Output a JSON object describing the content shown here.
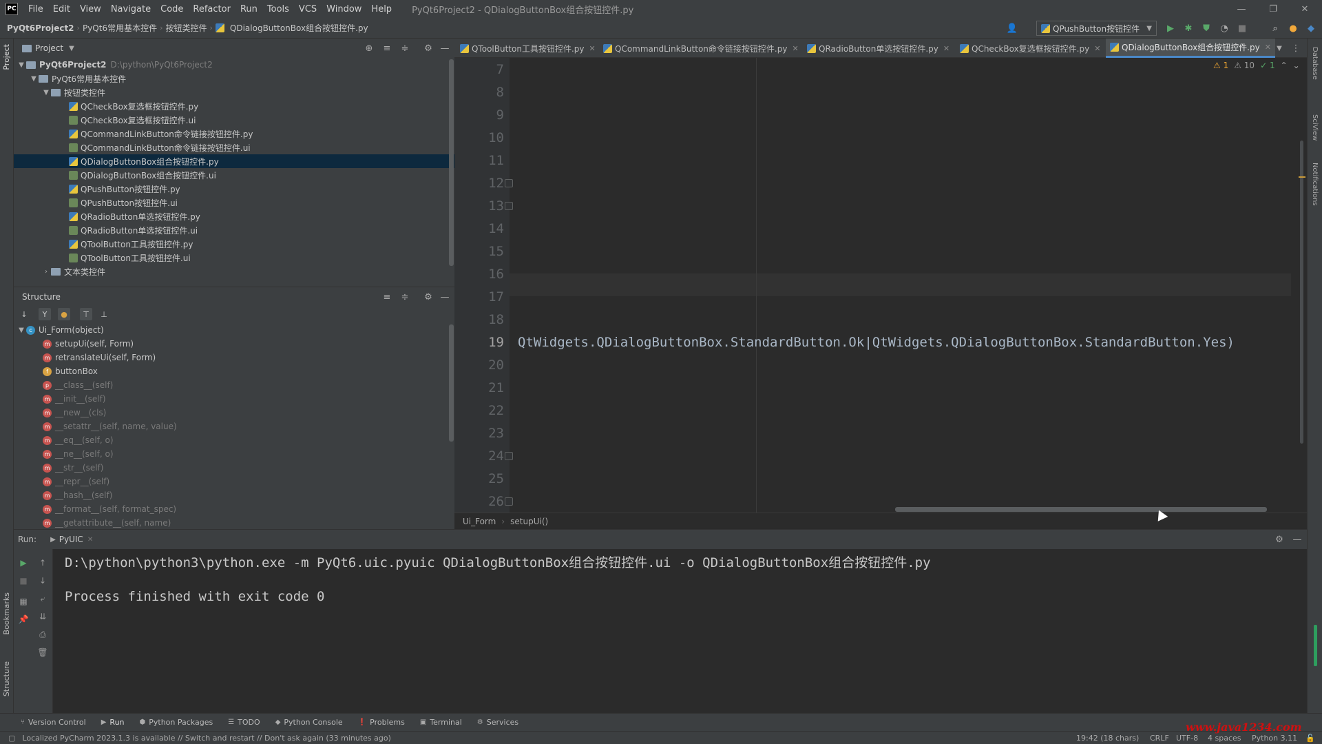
{
  "window": {
    "title": "PyQt6Project2 - QDialogButtonBox组合按钮控件.py",
    "logo": "PC"
  },
  "menu": [
    "File",
    "Edit",
    "View",
    "Navigate",
    "Code",
    "Refactor",
    "Run",
    "Tools",
    "VCS",
    "Window",
    "Help"
  ],
  "navbar": {
    "crumbs": [
      "PyQt6Project2",
      "PyQt6常用基本控件",
      "按钮类控件",
      "QDialogButtonBox组合按钮控件.py"
    ],
    "run_config": "QPushButton按钮控件"
  },
  "project": {
    "title": "Project",
    "root": "PyQt6Project2",
    "root_path": "D:\\python\\PyQt6Project2",
    "folder1": "PyQt6常用基本控件",
    "folder2": "按钮类控件",
    "files": [
      "QCheckBox复选框按钮控件.py",
      "QCheckBox复选框按钮控件.ui",
      "QCommandLinkButton命令链接按钮控件.py",
      "QCommandLinkButton命令链接按钮控件.ui",
      "QDialogButtonBox组合按钮控件.py",
      "QDialogButtonBox组合按钮控件.ui",
      "QPushButton按钮控件.py",
      "QPushButton按钮控件.ui",
      "QRadioButton单选按钮控件.py",
      "QRadioButton单选按钮控件.ui",
      "QToolButton工具按钮控件.py",
      "QToolButton工具按钮控件.ui"
    ],
    "folder3": "文本类控件"
  },
  "structure": {
    "title": "Structure",
    "class_name": "Ui_Form(object)",
    "members": [
      "setupUi(self, Form)",
      "retranslateUi(self, Form)",
      "buttonBox",
      "__class__(self)",
      "__init__(self)",
      "__new__(cls)",
      "__setattr__(self, name, value)",
      "__eq__(self, o)",
      "__ne__(self, o)",
      "__str__(self)",
      "__repr__(self)",
      "__hash__(self)",
      "__format__(self, format_spec)",
      "__getattribute__(self, name)"
    ]
  },
  "editor": {
    "tabs": [
      "QToolButton工具按钮控件.py",
      "QCommandLinkButton命令链接按钮控件.py",
      "QRadioButton单选按钮控件.py",
      "QCheckBox复选框按钮控件.py",
      "QDialogButtonBox组合按钮控件.py"
    ],
    "line_numbers": [
      "7",
      "8",
      "9",
      "10",
      "11",
      "12",
      "13",
      "14",
      "15",
      "16",
      "17",
      "18",
      "19",
      "20",
      "21",
      "22",
      "23",
      "24",
      "25",
      "26"
    ],
    "code_line": "QtWidgets.QDialogButtonBox.StandardButton.Ok|QtWidgets.QDialogButtonBox.StandardButton.Yes)",
    "inspections": {
      "warn_count": "1",
      "weak_count": "10",
      "ok_count": "1"
    },
    "breadcrumb": [
      "Ui_Form",
      "setupUi()"
    ]
  },
  "run": {
    "label": "Run:",
    "tab": "PyUIC",
    "command": "D:\\python\\python3\\python.exe -m PyQt6.uic.pyuic QDialogButtonBox组合按钮控件.ui -o QDialogButtonBox组合按钮控件.py",
    "result": "Process finished with exit code 0"
  },
  "bottom_tools": [
    "Version Control",
    "Run",
    "Python Packages",
    "TODO",
    "Python Console",
    "Problems",
    "Terminal",
    "Services"
  ],
  "left_stripe": [
    "Project",
    "Bookmarks",
    "Structure"
  ],
  "right_stripe": [
    "Database",
    "SciView",
    "Notifications"
  ],
  "status": {
    "message": "Localized PyCharm 2023.1.3 is available // Switch and restart // Don't ask again (33 minutes ago)",
    "position": "19:42 (18 chars)",
    "line_sep": "CRLF",
    "encoding": "UTF-8",
    "indent": "4 spaces",
    "interpreter": "Python 3.11"
  },
  "watermark": "www.java1234.com"
}
